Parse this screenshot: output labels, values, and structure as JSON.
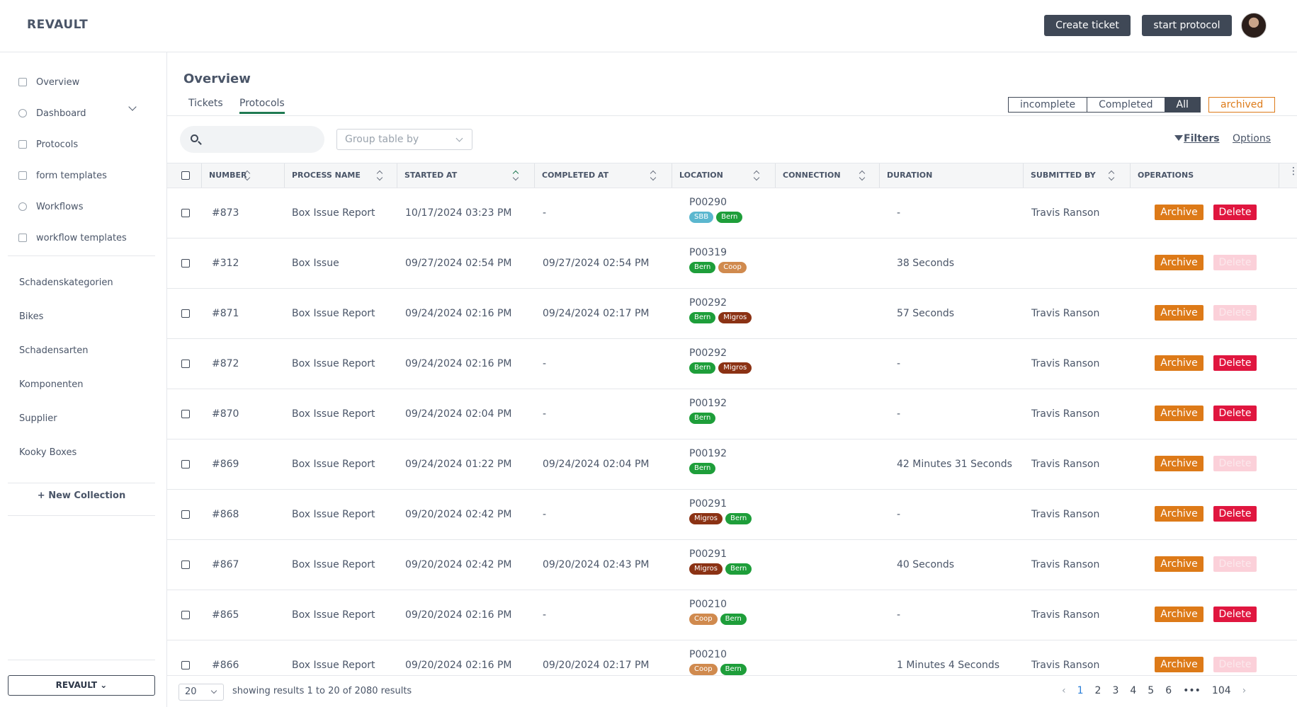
{
  "app": {
    "name": "REVAULT"
  },
  "header": {
    "create_ticket": "Create ticket",
    "start_protocol": "start protocol"
  },
  "sidebar": {
    "nav": [
      {
        "label": "Overview",
        "icon": "overview-icon"
      },
      {
        "label": "Dashboard",
        "icon": "dashboard-icon"
      },
      {
        "label": "Protocols",
        "icon": "protocols-icon"
      },
      {
        "label": "form templates",
        "icon": "form-templates-icon"
      },
      {
        "label": "Workflows",
        "icon": "workflows-icon"
      },
      {
        "label": "workflow templates",
        "icon": "workflow-templates-icon"
      }
    ],
    "collections": [
      "Schadenskategorien",
      "Bikes",
      "Schadensarten",
      "Komponenten",
      "Supplier",
      "Kooky Boxes"
    ],
    "new_collection": "+ New Collection",
    "workspace": "REVAULT"
  },
  "main": {
    "title": "Overview",
    "tabs": [
      "Tickets",
      "Protocols"
    ],
    "active_tab": "Protocols",
    "segments": [
      "incomplete",
      "Completed",
      "All"
    ],
    "selected_segment": "All",
    "archived": "archived",
    "search": {
      "value": "",
      "placeholder": ""
    },
    "group_by": "Group table by",
    "filters": "Filters",
    "options": "Options"
  },
  "table": {
    "columns": [
      "NUMBER",
      "PROCESS NAME",
      "STARTED AT",
      "COMPLETED AT",
      "LOCATION",
      "CONNECTION",
      "DURATION",
      "SUBMITTED BY",
      "OPERATIONS"
    ],
    "archive_label": "Archive",
    "delete_label": "Delete",
    "rows": [
      {
        "number": "#873",
        "process": "Box Issue Report",
        "started": "10/17/2024 03:23 PM",
        "completed": "-",
        "location": "P00290",
        "tags": [
          "SBB",
          "Bern"
        ],
        "connection": "",
        "duration": "-",
        "submitted_by": "Travis Ranson",
        "delete_enabled": true
      },
      {
        "number": "#312",
        "process": "Box Issue",
        "started": "09/27/2024 02:54 PM",
        "completed": "09/27/2024 02:54 PM",
        "location": "P00319",
        "tags": [
          "Bern",
          "Coop"
        ],
        "connection": "",
        "duration": "38 Seconds",
        "submitted_by": "",
        "delete_enabled": false
      },
      {
        "number": "#871",
        "process": "Box Issue Report",
        "started": "09/24/2024 02:16 PM",
        "completed": "09/24/2024 02:17 PM",
        "location": "P00292",
        "tags": [
          "Bern",
          "Migros"
        ],
        "connection": "",
        "duration": "57 Seconds",
        "submitted_by": "Travis Ranson",
        "delete_enabled": false
      },
      {
        "number": "#872",
        "process": "Box Issue Report",
        "started": "09/24/2024 02:16 PM",
        "completed": "-",
        "location": "P00292",
        "tags": [
          "Bern",
          "Migros"
        ],
        "connection": "",
        "duration": "-",
        "submitted_by": "Travis Ranson",
        "delete_enabled": true
      },
      {
        "number": "#870",
        "process": "Box Issue Report",
        "started": "09/24/2024 02:04 PM",
        "completed": "-",
        "location": "P00192",
        "tags": [
          "Bern"
        ],
        "connection": "",
        "duration": "-",
        "submitted_by": "Travis Ranson",
        "delete_enabled": true
      },
      {
        "number": "#869",
        "process": "Box Issue Report",
        "started": "09/24/2024 01:22 PM",
        "completed": "09/24/2024 02:04 PM",
        "location": "P00192",
        "tags": [
          "Bern"
        ],
        "connection": "",
        "duration": "42 Minutes 31 Seconds",
        "submitted_by": "Travis Ranson",
        "delete_enabled": false
      },
      {
        "number": "#868",
        "process": "Box Issue Report",
        "started": "09/20/2024 02:42 PM",
        "completed": "-",
        "location": "P00291",
        "tags": [
          "Migros",
          "Bern"
        ],
        "connection": "",
        "duration": "-",
        "submitted_by": "Travis Ranson",
        "delete_enabled": true
      },
      {
        "number": "#867",
        "process": "Box Issue Report",
        "started": "09/20/2024 02:42 PM",
        "completed": "09/20/2024 02:43 PM",
        "location": "P00291",
        "tags": [
          "Migros",
          "Bern"
        ],
        "connection": "",
        "duration": "40 Seconds",
        "submitted_by": "Travis Ranson",
        "delete_enabled": false
      },
      {
        "number": "#865",
        "process": "Box Issue Report",
        "started": "09/20/2024 02:16 PM",
        "completed": "-",
        "location": "P00210",
        "tags": [
          "Coop",
          "Bern"
        ],
        "connection": "",
        "duration": "-",
        "submitted_by": "Travis Ranson",
        "delete_enabled": true
      },
      {
        "number": "#866",
        "process": "Box Issue Report",
        "started": "09/20/2024 02:16 PM",
        "completed": "09/20/2024 02:17 PM",
        "location": "P00210",
        "tags": [
          "Coop",
          "Bern"
        ],
        "connection": "",
        "duration": "1 Minutes 4 Seconds",
        "submitted_by": "Travis Ranson",
        "delete_enabled": false
      }
    ]
  },
  "tag_colors": {
    "SBB": "#5bb7cf",
    "Bern": "#1e9e3a",
    "Coop": "#d08a4e",
    "Migros": "#8b3214"
  },
  "footer": {
    "page_size": "20",
    "showing": "showing results 1 to 20 of 2080 results",
    "pages": [
      "1",
      "2",
      "3",
      "4",
      "5",
      "6",
      "•••",
      "104"
    ],
    "current_page": "1"
  }
}
